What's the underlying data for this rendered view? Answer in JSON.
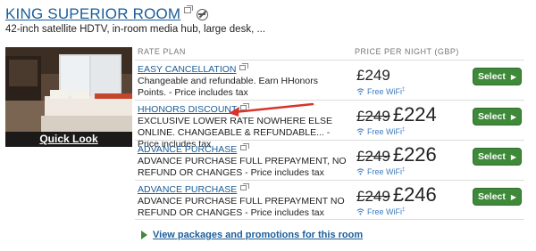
{
  "room": {
    "title": "KING SUPERIOR ROOM",
    "description": "42-inch satellite HDTV, in-room media hub, large desk, ...",
    "quick_look": "Quick Look",
    "icons": [
      "external-link-icon",
      "no-smoking-icon"
    ]
  },
  "table": {
    "col_plan": "RATE PLAN",
    "col_price": "PRICE PER NIGHT (GBP)",
    "rows": [
      {
        "name": "EASY CANCELLATION",
        "desc": "Changeable and refundable. Earn HHonors Points. - Price includes tax",
        "old_price": "",
        "price": "£249",
        "wifi": "Free WiFi",
        "wifi_mark": "‡",
        "button": "Select"
      },
      {
        "name": "HHONORS DISCOUNT",
        "desc": "EXCLUSIVE LOWER RATE NOWHERE ELSE ONLINE. CHANGEABLE & REFUNDABLE... - Price includes tax",
        "old_price": "£249",
        "price": "£224",
        "wifi": "Free WiFi",
        "wifi_mark": "‡",
        "button": "Select"
      },
      {
        "name": "ADVANCE PURCHASE",
        "desc": "ADVANCE PURCHASE FULL PREPAYMENT, NO REFUND OR CHANGES - Price includes tax",
        "old_price": "£249",
        "price": "£226",
        "wifi": "Free WiFi",
        "wifi_mark": "‡",
        "button": "Select"
      },
      {
        "name": "ADVANCE PURCHASE",
        "desc": "ADVANCE PURCHASE FULL PREPAYMENT NO REFUND OR CHANGES - Price includes tax",
        "old_price": "£249",
        "price": "£246",
        "wifi": "Free WiFi",
        "wifi_mark": "‡",
        "button": "Select"
      }
    ]
  },
  "packages_link": "View packages and promotions for this room",
  "colors": {
    "link": "#1a5d9a",
    "button": "#3f8a3a",
    "annotation_arrow": "#d9342b",
    "wifi": "#3d7cbf"
  }
}
